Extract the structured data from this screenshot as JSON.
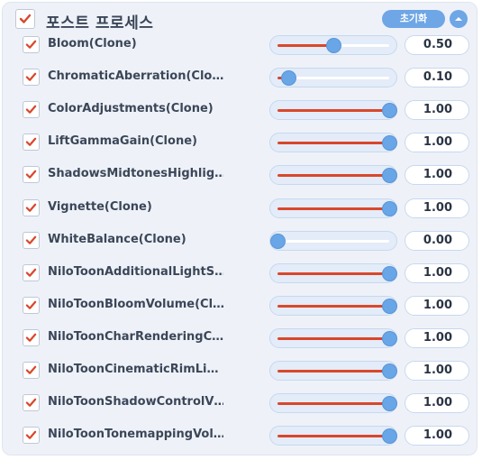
{
  "header": {
    "title": "포스트 프로세스",
    "enabled": true,
    "reset_label": "초기화",
    "collapse_icon": "chevron-up-icon"
  },
  "colors": {
    "accent": "#6ea6e6",
    "fill": "#d9472b",
    "check": "#d9472b"
  },
  "rows": [
    {
      "label": "Bloom(Clone)",
      "value": "0.50",
      "level": 0.5,
      "enabled": true
    },
    {
      "label": "ChromaticAberration(Clo…",
      "value": "0.10",
      "level": 0.1,
      "enabled": true
    },
    {
      "label": "ColorAdjustments(Clone)",
      "value": "1.00",
      "level": 1.0,
      "enabled": true
    },
    {
      "label": "LiftGammaGain(Clone)",
      "value": "1.00",
      "level": 1.0,
      "enabled": true
    },
    {
      "label": "ShadowsMidtonesHighlig…",
      "value": "1.00",
      "level": 1.0,
      "enabled": true
    },
    {
      "label": "Vignette(Clone)",
      "value": "1.00",
      "level": 1.0,
      "enabled": true
    },
    {
      "label": "WhiteBalance(Clone)",
      "value": "0.00",
      "level": 0.0,
      "enabled": true
    },
    {
      "label": "NiloToonAdditionalLightS…",
      "value": "1.00",
      "level": 1.0,
      "enabled": true
    },
    {
      "label": "NiloToonBloomVolume(Cl…",
      "value": "1.00",
      "level": 1.0,
      "enabled": true
    },
    {
      "label": "NiloToonCharRenderingC…",
      "value": "1.00",
      "level": 1.0,
      "enabled": true
    },
    {
      "label": "NiloToonCinematicRimLi…",
      "value": "1.00",
      "level": 1.0,
      "enabled": true
    },
    {
      "label": "NiloToonShadowControlV…",
      "value": "1.00",
      "level": 1.0,
      "enabled": true
    },
    {
      "label": "NiloToonTonemappingVol…",
      "value": "1.00",
      "level": 1.0,
      "enabled": true
    }
  ]
}
